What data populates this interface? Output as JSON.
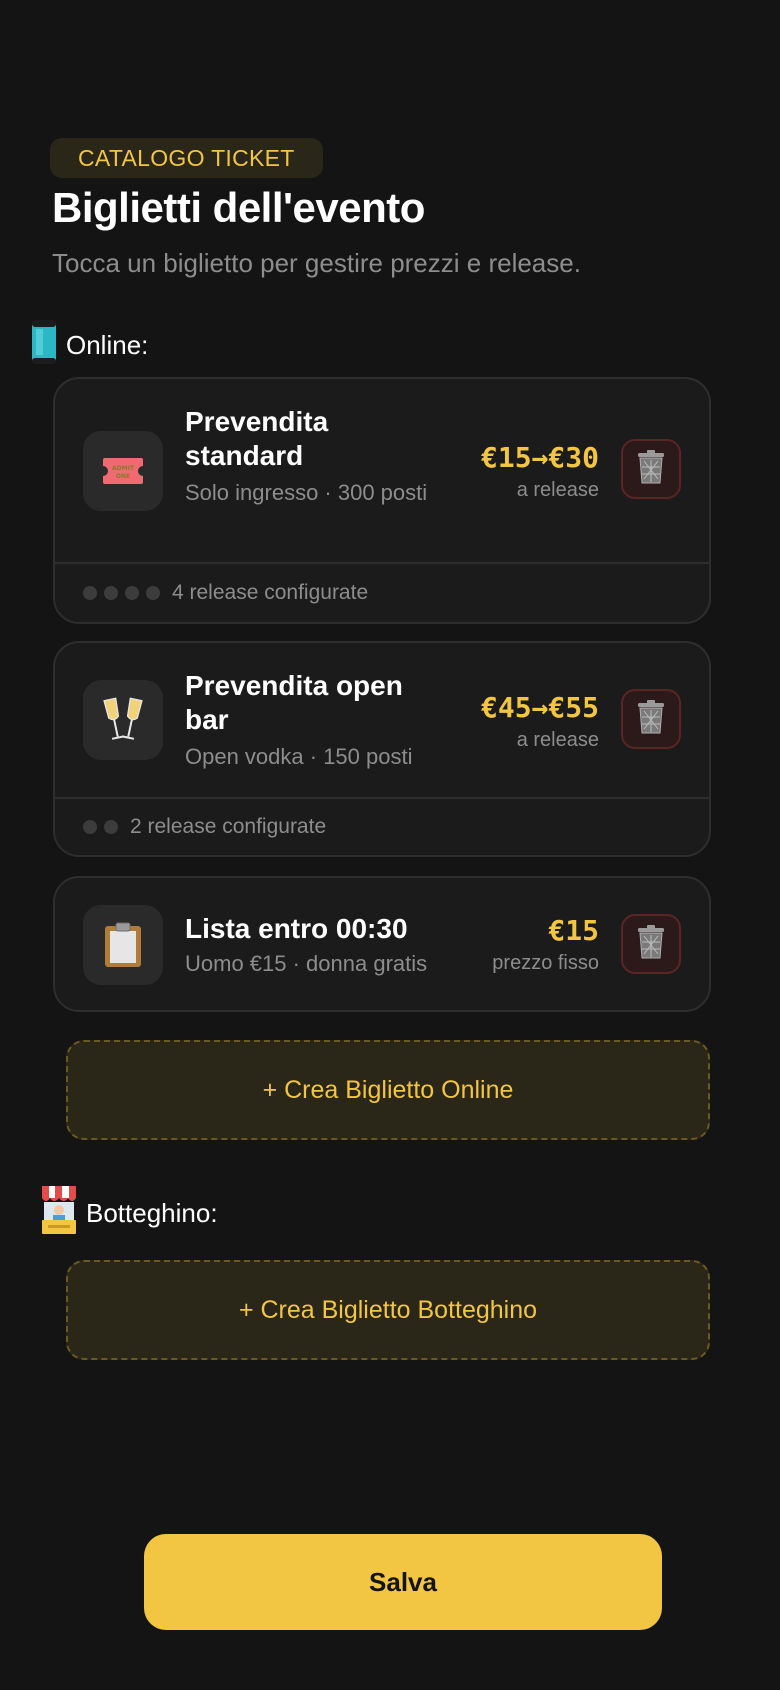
{
  "header": {
    "badge": "CATALOGO TICKET",
    "title": "Biglietti dell'evento",
    "subtitle": "Tocca un biglietto per gestire prezzi e release."
  },
  "online": {
    "label": "Online:",
    "icon": "phone-icon",
    "tickets": [
      {
        "name": "Prevendita standard",
        "description": "Solo ingresso · 300 posti",
        "price": "€15→€30",
        "price_note": "a release",
        "icon": "admit-one-ticket-icon",
        "icon_text": "ADMIT ONE",
        "footer": "4 release configurate",
        "release_count": 4
      },
      {
        "name": "Prevendita open bar",
        "description": "Open vodka · 150 posti",
        "price": "€45→€55",
        "price_note": "a release",
        "icon": "champagne-glasses-icon",
        "footer": "2 release configurate",
        "release_count": 2
      },
      {
        "name": "Lista entro 00:30",
        "description": "Uomo €15 · donna gratis",
        "price": "€15",
        "price_note": "prezzo fisso",
        "icon": "clipboard-icon"
      }
    ],
    "create_label": "+ Crea Biglietto Online"
  },
  "box_office": {
    "label": "Botteghino:",
    "icon": "ticket-booth-icon",
    "create_label": "+ Crea Biglietto Botteghino"
  },
  "save_label": "Salva",
  "colors": {
    "background": "#141414",
    "accent": "#f2c542",
    "card": "#1b1b1b",
    "muted_text": "#8d8d8d"
  }
}
